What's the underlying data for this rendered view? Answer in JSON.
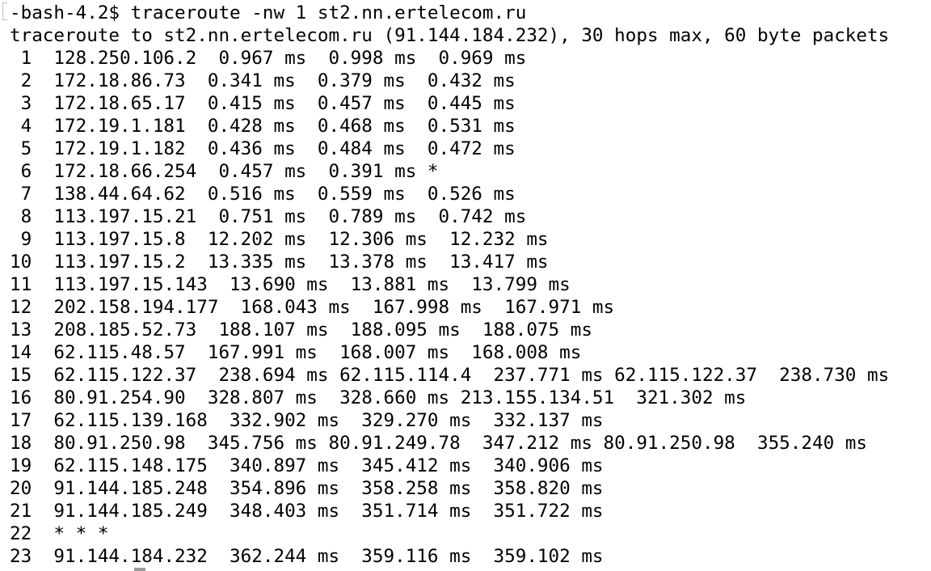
{
  "terminal": {
    "prompt": "-bash-4.2$ traceroute -nw 1 st2.nn.ertelecom.ru",
    "header": "traceroute to st2.nn.ertelecom.ru (91.144.184.232), 30 hops max, 60 byte packets",
    "hops": [
      " 1  128.250.106.2  0.967 ms  0.998 ms  0.969 ms",
      " 2  172.18.86.73  0.341 ms  0.379 ms  0.432 ms",
      " 3  172.18.65.17  0.415 ms  0.457 ms  0.445 ms",
      " 4  172.19.1.181  0.428 ms  0.468 ms  0.531 ms",
      " 5  172.19.1.182  0.436 ms  0.484 ms  0.472 ms",
      " 6  172.18.66.254  0.457 ms  0.391 ms *",
      " 7  138.44.64.62  0.516 ms  0.559 ms  0.526 ms",
      " 8  113.197.15.21  0.751 ms  0.789 ms  0.742 ms",
      " 9  113.197.15.8  12.202 ms  12.306 ms  12.232 ms",
      "10  113.197.15.2  13.335 ms  13.378 ms  13.417 ms",
      "11  113.197.15.143  13.690 ms  13.881 ms  13.799 ms",
      "12  202.158.194.177  168.043 ms  167.998 ms  167.971 ms",
      "13  208.185.52.73  188.107 ms  188.095 ms  188.075 ms",
      "14  62.115.48.57  167.991 ms  168.007 ms  168.008 ms",
      "15  62.115.122.37  238.694 ms 62.115.114.4  237.771 ms 62.115.122.37  238.730 ms",
      "16  80.91.254.90  328.807 ms  328.660 ms 213.155.134.51  321.302 ms",
      "17  62.115.139.168  332.902 ms  329.270 ms  332.137 ms",
      "18  80.91.250.98  345.756 ms 80.91.249.78  347.212 ms 80.91.250.98  355.240 ms",
      "19  62.115.148.175  340.897 ms  345.412 ms  340.906 ms",
      "20  91.144.185.248  354.896 ms  358.258 ms  358.820 ms",
      "21  91.144.185.249  348.403 ms  351.714 ms  351.722 ms",
      "22  * * *",
      "23  91.144.184.232  362.244 ms  359.116 ms  359.102 ms"
    ]
  }
}
